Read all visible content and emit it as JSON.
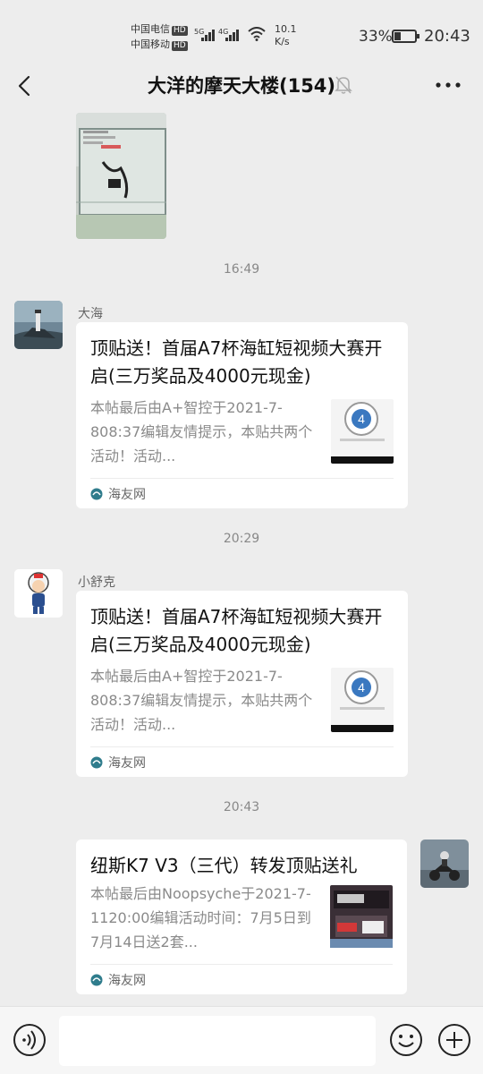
{
  "status_bar": {
    "carrier1": "中国电信",
    "carrier2": "中国移动",
    "hd": "HD",
    "net1": "5G",
    "net2": "4G",
    "speed_value": "10.1",
    "speed_unit": "K/s",
    "battery_percent": "33%",
    "battery_level": 0.33,
    "time": "20:43"
  },
  "nav": {
    "title": "大洋的摩天大楼(154)",
    "back_icon": "chevron-left-icon",
    "mute_icon": "bell-off-icon",
    "more_icon": "more-dots-icon"
  },
  "messages": {
    "time1": "16:49",
    "time2": "20:29",
    "time3": "20:43",
    "card1": {
      "sender": "大海",
      "title": "顶贴送！首届A7杯海缸短视频大赛开启(三万奖品及4000元现金)",
      "desc": "本帖最后由A+智控于2021-7-808:37编辑友情提示，本贴共两个活动！活动...",
      "source": "海友网"
    },
    "card2": {
      "sender": "小舒克",
      "title": "顶贴送！首届A7杯海缸短视频大赛开启(三万奖品及4000元现金)",
      "desc": "本帖最后由A+智控于2021-7-808:37编辑友情提示，本贴共两个活动！活动...",
      "source": "海友网"
    },
    "card3": {
      "title": "纽斯K7 V3（三代）转发顶贴送礼",
      "desc": "本帖最后由Noopsyche于2021-7-1120:00编辑活动时间：7月5日到7月14日送2套...",
      "source": "海友网"
    }
  },
  "input_bar": {
    "placeholder": "",
    "voice_icon": "voice-icon",
    "emoji_icon": "emoji-icon",
    "plus_icon": "plus-icon"
  }
}
